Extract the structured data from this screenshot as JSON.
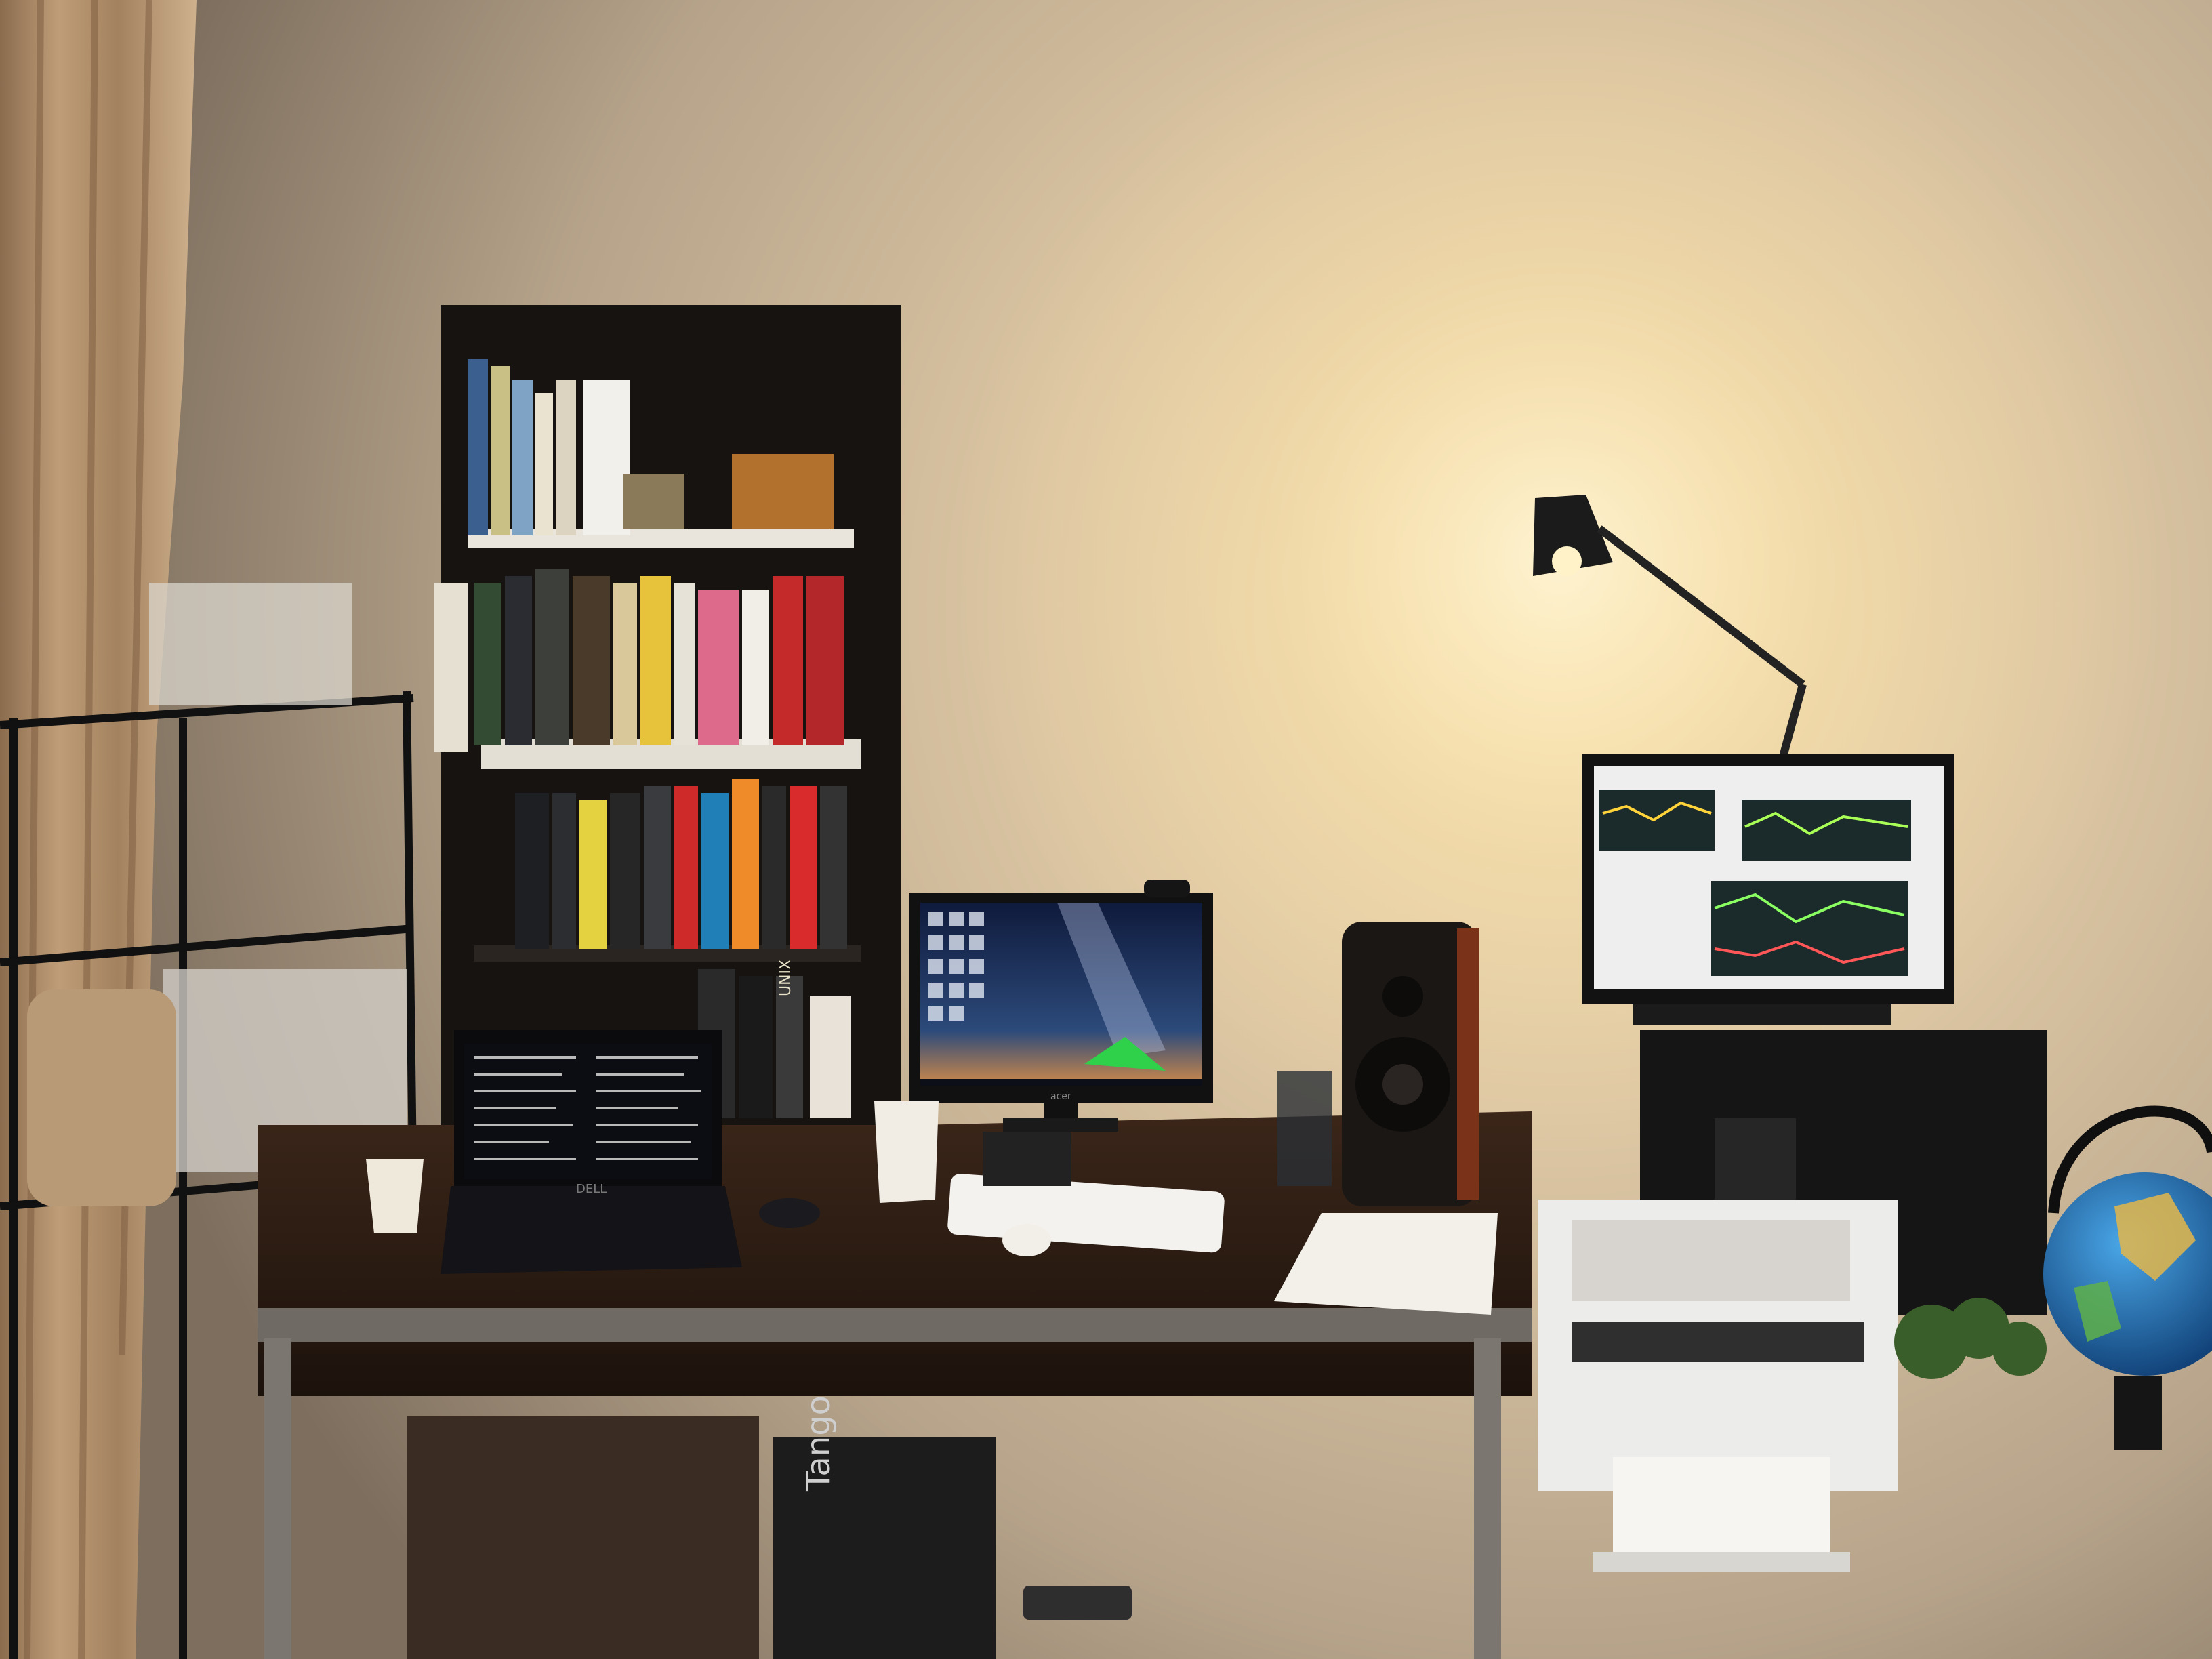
{
  "image": {
    "kind": "photo",
    "subject": "home office desk at night",
    "printed_text": {
      "laptop_brand": "DELL",
      "monitor_brand": "acer",
      "box_label": "Tango",
      "book_spine": "UNIX"
    }
  },
  "colors": {
    "wall_lit": "#f1d9a8",
    "wall_mid": "#c9b394",
    "wall_dark": "#6f6151",
    "curtain": "#b59571",
    "shelf": "#141210",
    "desk_top": "#2c1d14",
    "desk_frame": "#7b7770",
    "lamp_glow": "#fff2c8",
    "screen_wallpaper": "#1a2d57",
    "terminal_bg": "#0c0d12",
    "chart_screen": "#eeeeee",
    "printer": "#ececea",
    "speaker_wood": "#7a3218",
    "globe_ocean": "#1f6fb5",
    "tent_green": "#2fd14a"
  },
  "icons": [
    "lamp-icon",
    "monitor-icon",
    "laptop-icon",
    "speaker-icon",
    "printer-icon",
    "globe-icon",
    "headphones-icon"
  ]
}
